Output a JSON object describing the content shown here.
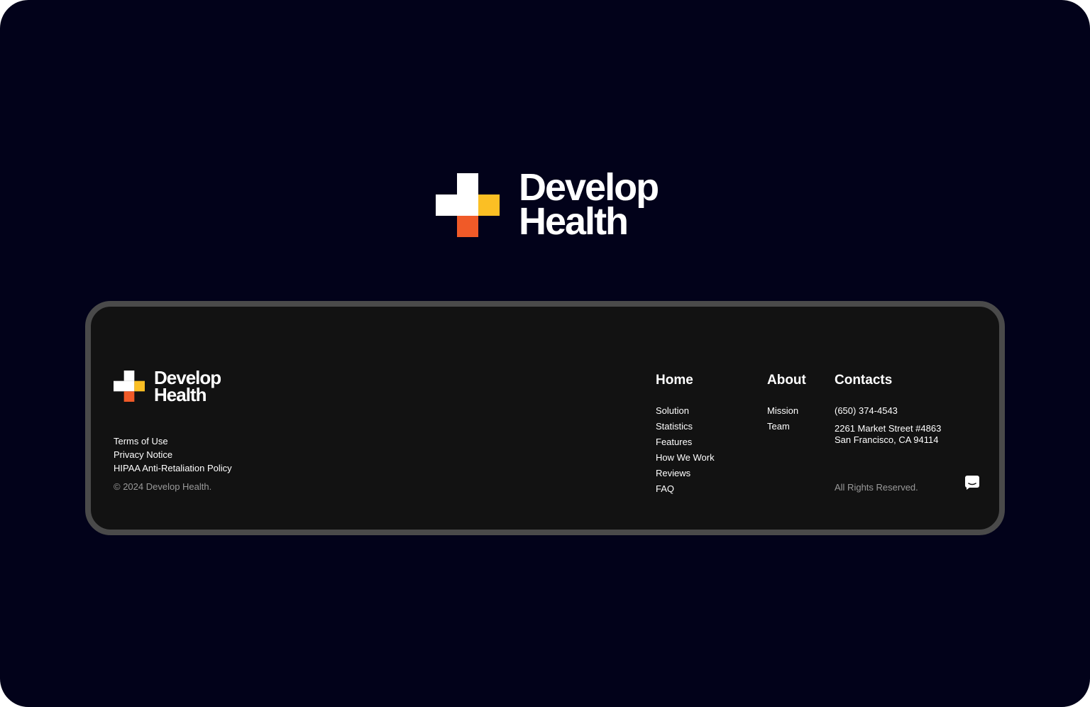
{
  "brand": {
    "line1": "Develop",
    "line2": "Health",
    "colors": {
      "background": "#02021a",
      "card": "#121212",
      "card_border": "#4a4a4a",
      "mark_white": "#ffffff",
      "mark_yellow": "#fbbf24",
      "mark_orange": "#f05a28"
    }
  },
  "footer": {
    "legal_links": [
      "Terms of Use",
      "Privacy Notice",
      "HIPAA Anti-Retaliation Policy"
    ],
    "copyright": "© 2024 Develop Health.",
    "home": {
      "title": "Home",
      "links": [
        "Solution",
        "Statistics",
        "Features",
        "How We Work",
        "Reviews",
        "FAQ"
      ]
    },
    "about": {
      "title": "About",
      "links": [
        "Mission",
        "Team"
      ]
    },
    "contacts": {
      "title": "Contacts",
      "phone": "(650) 374-4543",
      "address_line1": "2261 Market Street #4863",
      "address_line2": "San Francisco, CA 94114"
    },
    "rights": "All Rights Reserved.",
    "chat_icon": "chat-icon"
  }
}
